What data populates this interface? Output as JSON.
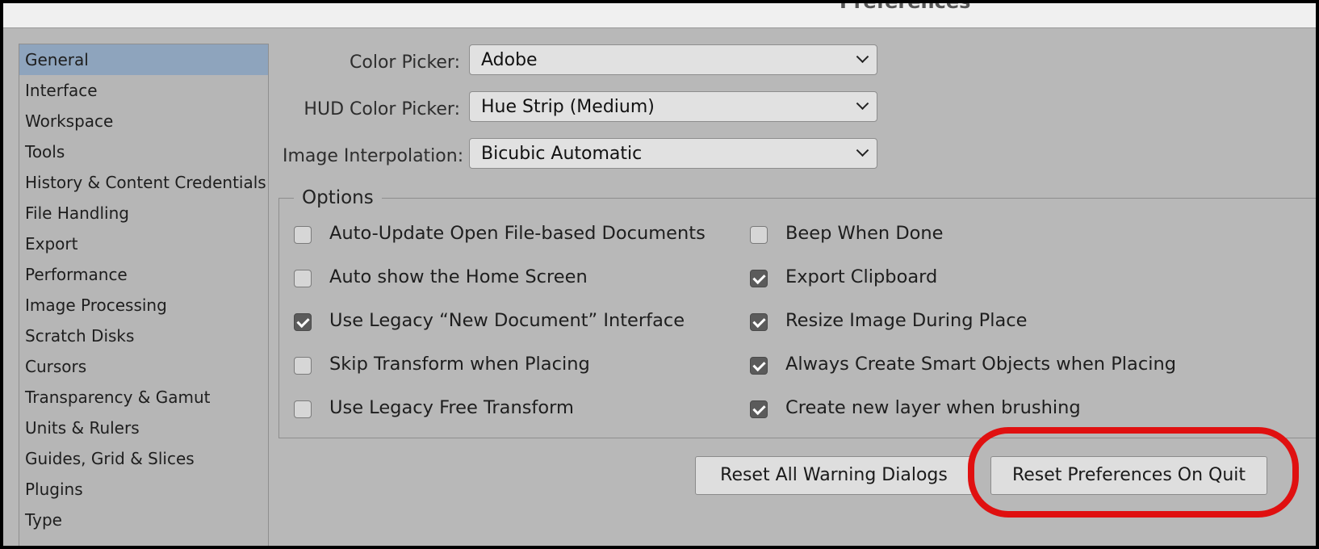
{
  "window": {
    "title": "Preferences"
  },
  "sidebar": {
    "items": [
      {
        "label": "General",
        "selected": true
      },
      {
        "label": "Interface"
      },
      {
        "label": "Workspace"
      },
      {
        "label": "Tools"
      },
      {
        "label": "History & Content Credentials"
      },
      {
        "label": "File Handling"
      },
      {
        "label": "Export"
      },
      {
        "label": "Performance"
      },
      {
        "label": "Image Processing"
      },
      {
        "label": "Scratch Disks"
      },
      {
        "label": "Cursors"
      },
      {
        "label": "Transparency & Gamut"
      },
      {
        "label": "Units & Rulers"
      },
      {
        "label": "Guides, Grid & Slices"
      },
      {
        "label": "Plugins"
      },
      {
        "label": "Type"
      }
    ]
  },
  "fields": {
    "color_picker": {
      "label": "Color Picker:",
      "value": "Adobe"
    },
    "hud_color_picker": {
      "label": "HUD Color Picker:",
      "value": "Hue Strip (Medium)"
    },
    "image_interpolation": {
      "label": "Image Interpolation:",
      "value": "Bicubic Automatic"
    }
  },
  "options": {
    "legend": "Options",
    "left": [
      {
        "label": "Auto-Update Open File-based Documents",
        "checked": false
      },
      {
        "label": "Auto show the Home Screen",
        "checked": false
      },
      {
        "label": "Use Legacy “New Document” Interface",
        "checked": true
      },
      {
        "label": "Skip Transform when Placing",
        "checked": false
      },
      {
        "label": "Use Legacy Free Transform",
        "checked": false
      }
    ],
    "right": [
      {
        "label": "Beep When Done",
        "checked": false
      },
      {
        "label": "Export Clipboard",
        "checked": true
      },
      {
        "label": "Resize Image During Place",
        "checked": true
      },
      {
        "label": "Always Create Smart Objects when Placing",
        "checked": true
      },
      {
        "label": "Create new layer when brushing",
        "checked": true
      }
    ]
  },
  "buttons": {
    "reset_warnings": "Reset All Warning Dialogs",
    "reset_prefs": "Reset Preferences On Quit"
  },
  "colors": {
    "highlight": "#e01010",
    "selected_item": "#8ea4bd"
  }
}
